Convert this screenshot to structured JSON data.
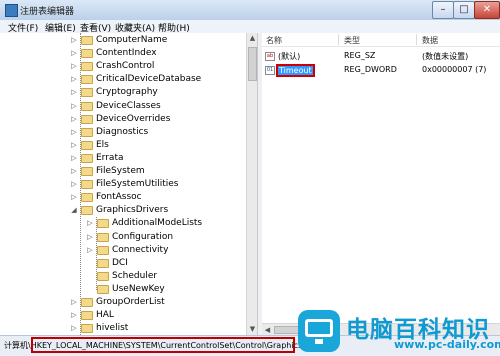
{
  "window": {
    "title": "注册表编辑器",
    "controls": {
      "minimize": "–",
      "maximize": "□",
      "close": "✕"
    }
  },
  "menu": [
    "文件(F)",
    "编辑(E)",
    "查看(V)",
    "收藏夹(A)",
    "帮助(H)"
  ],
  "tree": {
    "items": [
      {
        "label": "ComputerName",
        "expander": "▷"
      },
      {
        "label": "ContentIndex",
        "expander": "▷"
      },
      {
        "label": "CrashControl",
        "expander": "▷"
      },
      {
        "label": "CriticalDeviceDatabase",
        "expander": "▷"
      },
      {
        "label": "Cryptography",
        "expander": "▷"
      },
      {
        "label": "DeviceClasses",
        "expander": "▷"
      },
      {
        "label": "DeviceOverrides",
        "expander": "▷"
      },
      {
        "label": "Diagnostics",
        "expander": "▷"
      },
      {
        "label": "Els",
        "expander": "▷"
      },
      {
        "label": "Errata",
        "expander": "▷"
      },
      {
        "label": "FileSystem",
        "expander": "▷"
      },
      {
        "label": "FileSystemUtilities",
        "expander": "▷"
      },
      {
        "label": "FontAssoc",
        "expander": "▷"
      },
      {
        "label": "GraphicsDrivers",
        "expander": "◢"
      },
      {
        "label": "AdditionalModeLists",
        "expander": "▷"
      },
      {
        "label": "Configuration",
        "expander": "▷"
      },
      {
        "label": "Connectivity",
        "expander": "▷"
      },
      {
        "label": "DCI",
        "expander": ""
      },
      {
        "label": "Scheduler",
        "expander": ""
      },
      {
        "label": "UseNewKey",
        "expander": ""
      },
      {
        "label": "GroupOrderList",
        "expander": "▷"
      },
      {
        "label": "HAL",
        "expander": "▷"
      },
      {
        "label": "hivelist",
        "expander": "▷"
      }
    ]
  },
  "list": {
    "headers": {
      "name": "名称",
      "type": "类型",
      "data": "数据"
    },
    "rows": [
      {
        "icon": "ab",
        "name": "(默认)",
        "type": "REG_SZ",
        "data": "(数值未设置)"
      },
      {
        "icon": "01",
        "name": "Timeout",
        "type": "REG_DWORD",
        "data": "0x00000007 (7)"
      }
    ]
  },
  "status": {
    "text": "计算机\\HKEY_LOCAL_MACHINE\\SYSTEM\\CurrentControlSet\\Control\\GraphicsDrivers"
  },
  "watermark": {
    "cn": "电脑百科知识",
    "en": "www.pc-daily.com"
  },
  "colors": {
    "selection": "#3399ff",
    "highlight_box": "#c00000",
    "watermark": "#0f9ad2"
  }
}
